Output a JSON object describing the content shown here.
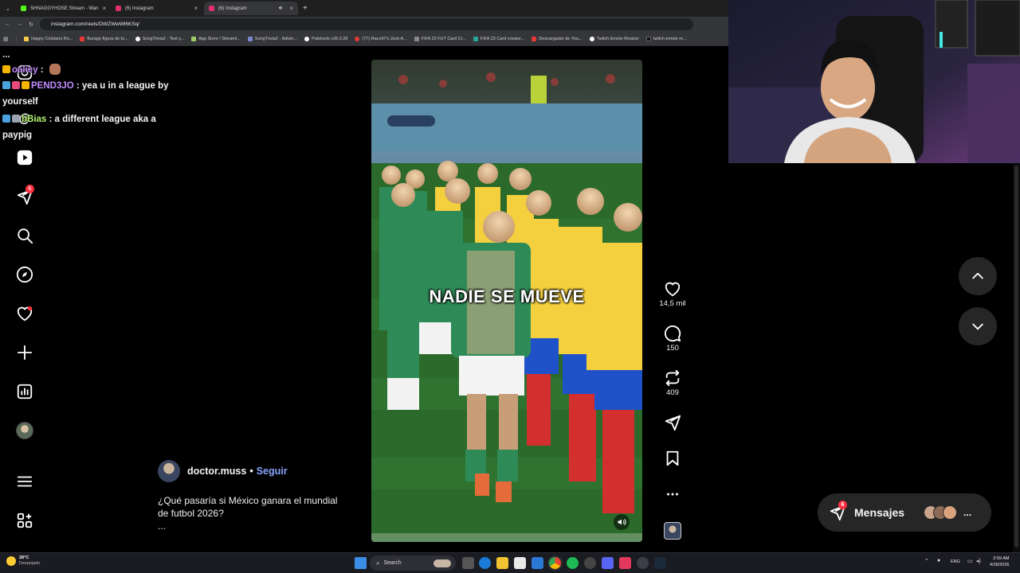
{
  "browser": {
    "tabs": [
      {
        "title": "SHNAGGYHOSE Stream - Wan",
        "color": "#53fc18",
        "active": false
      },
      {
        "title": "(6) Instagram",
        "color": "#e1306c",
        "active": false
      },
      {
        "title": "(6) Instagram",
        "color": "#e1306c",
        "active": true
      }
    ],
    "new_tab_label": "+",
    "url": "instagram.com/reels/DWZWwWl6KSq/",
    "bookmarks": [
      {
        "label": "Happy Cristiano Ro...",
        "color": "#f7c948"
      },
      {
        "label": "Burago figura de to...",
        "color": "#e53935"
      },
      {
        "label": "SongTrivia2 - Test y...",
        "color": "#ffffff"
      },
      {
        "label": "App Store / Streami...",
        "color": "#9ccc65"
      },
      {
        "label": "SongTrivia2 - Adivin...",
        "color": "#7986cb"
      },
      {
        "label": "Paletools v26.0.28",
        "color": "#ffffff"
      },
      {
        "label": "(77) Raco97's Zest-A...",
        "color": "#e53935"
      },
      {
        "label": "FIFA 23 FUT Card Cr...",
        "color": "#888888"
      },
      {
        "label": "FIFA 23 Card creator...",
        "color": "#26a69a"
      },
      {
        "label": "Descargador de You...",
        "color": "#e53935"
      },
      {
        "label": "Twitch Emote Resizer",
        "color": "#ffffff"
      },
      {
        "label": "twitch emote re...",
        "color": "#111111"
      }
    ]
  },
  "nav": {
    "messages_badge": "6"
  },
  "chat": [
    {
      "user": "",
      "text": "",
      "partial": "... ",
      "color": "#ffffff"
    },
    {
      "user": "oaliey",
      "sep": " :",
      "text": "",
      "color": "#c28bff"
    },
    {
      "user": "PEND3JO",
      "sep": " :",
      "text": " yea u in a league by yourself",
      "color": "#c28bff"
    },
    {
      "user": "bBias",
      "sep": " :",
      "text": " a different league aka a paypig",
      "color": "#b4f36e"
    }
  ],
  "reel": {
    "overlay_text": "NADIE SE MUEVE",
    "likes": "14,5 mil",
    "comments": "150",
    "reposts": "409"
  },
  "author": {
    "username": "doctor.muss",
    "separator": "•",
    "follow_label": "Seguir",
    "description": "¿Qué pasaría si México ganara el mundial de futbol 2026?",
    "more": "..."
  },
  "messages": {
    "label": "Mensajes",
    "badge": "6",
    "more": "..."
  },
  "taskbar": {
    "weather_temp": "28°C",
    "weather_text": "Despejado",
    "search_label": "Search",
    "language": "ENG",
    "time": "2:59 AM",
    "date": "4/28/2026"
  },
  "colors": {
    "accent": "#0095f6",
    "badge": "#ff3040",
    "follow": "#8aa4ff",
    "mexico_green": "#2e8b57",
    "colombia_yellow": "#f4d03f"
  }
}
